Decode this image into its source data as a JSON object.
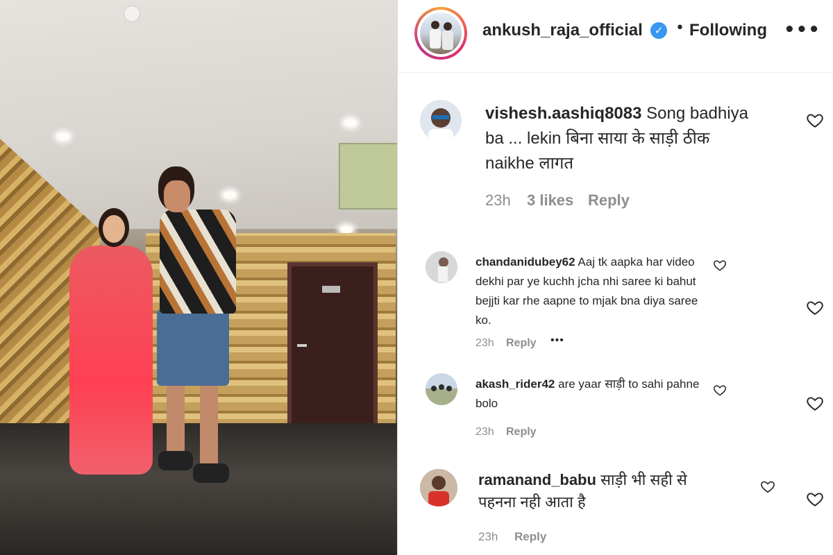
{
  "post": {
    "username": "ankush_raja_official",
    "separator": "•",
    "following_label": "Following",
    "more_label": "•••",
    "verified_glyph": "✓"
  },
  "comments": [
    {
      "username": "vishesh.aashiq8083",
      "text": "Song badhiya ba ... lekin बिना साया के साड़ी ठीक naikhe लागत",
      "time": "23h",
      "likes": "3 likes",
      "reply_label": "Reply"
    },
    {
      "username": "chandanidubey62",
      "text": "Aaj tk aapka har video dekhi par ye kuchh jcha nhi saree ki bahut bejjti kar rhe aapne to mjak bna diya saree ko.",
      "time": "23h",
      "reply_label": "Reply",
      "more_label": "•••"
    },
    {
      "username": "akash_rider42",
      "text": "are yaar साड़ी to sahi pahne bolo",
      "time": "23h",
      "reply_label": "Reply"
    },
    {
      "username": "ramanand_babu",
      "text": "साड़ी भी सही से पहनना नही आता है",
      "time": "23h",
      "reply_label": "Reply"
    }
  ],
  "icons": {
    "heart": "heart-outline-icon",
    "verified": "verified-badge-icon",
    "more": "more-options-icon"
  },
  "colors": {
    "text": "#262626",
    "meta": "#8e8e8e",
    "verified": "#3897f0",
    "divider": "#efefef"
  }
}
